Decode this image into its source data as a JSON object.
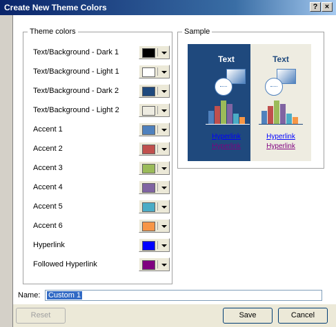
{
  "window": {
    "title": "Create New Theme Colors",
    "help_btn": "?",
    "close_btn": "×"
  },
  "theme_group": {
    "label": "Theme colors",
    "rows": [
      {
        "label": "Text/Background - Dark 1",
        "color": "#000000"
      },
      {
        "label": "Text/Background - Light 1",
        "color": "#ffffff"
      },
      {
        "label": "Text/Background - Dark 2",
        "color": "#1f497d"
      },
      {
        "label": "Text/Background - Light 2",
        "color": "#eeece1"
      },
      {
        "label": "Accent 1",
        "color": "#4f81bd"
      },
      {
        "label": "Accent 2",
        "color": "#c0504d"
      },
      {
        "label": "Accent 3",
        "color": "#9bbb59"
      },
      {
        "label": "Accent 4",
        "color": "#8064a2"
      },
      {
        "label": "Accent 5",
        "color": "#4bacc6"
      },
      {
        "label": "Accent 6",
        "color": "#f79646"
      },
      {
        "label": "Hyperlink",
        "color": "#0000ff"
      },
      {
        "label": "Followed Hyperlink",
        "color": "#800080"
      }
    ]
  },
  "sample_group": {
    "label": "Sample",
    "dark": {
      "text": "Text",
      "hyperlink": "Hyperlink",
      "followed": "Hyperlink",
      "bg": "#1f497d",
      "fg": "#ffffff"
    },
    "light": {
      "text": "Text",
      "hyperlink": "Hyperlink",
      "followed": "Hyperlink",
      "bg": "#eeece1",
      "fg": "#1f497d"
    },
    "accent_colors": [
      "#4f81bd",
      "#c0504d",
      "#9bbb59",
      "#8064a2",
      "#4bacc6",
      "#f79646"
    ]
  },
  "name_field": {
    "label": "Name:",
    "value": "Custom 1"
  },
  "buttons": {
    "reset": "Reset",
    "save": "Save",
    "cancel": "Cancel"
  }
}
